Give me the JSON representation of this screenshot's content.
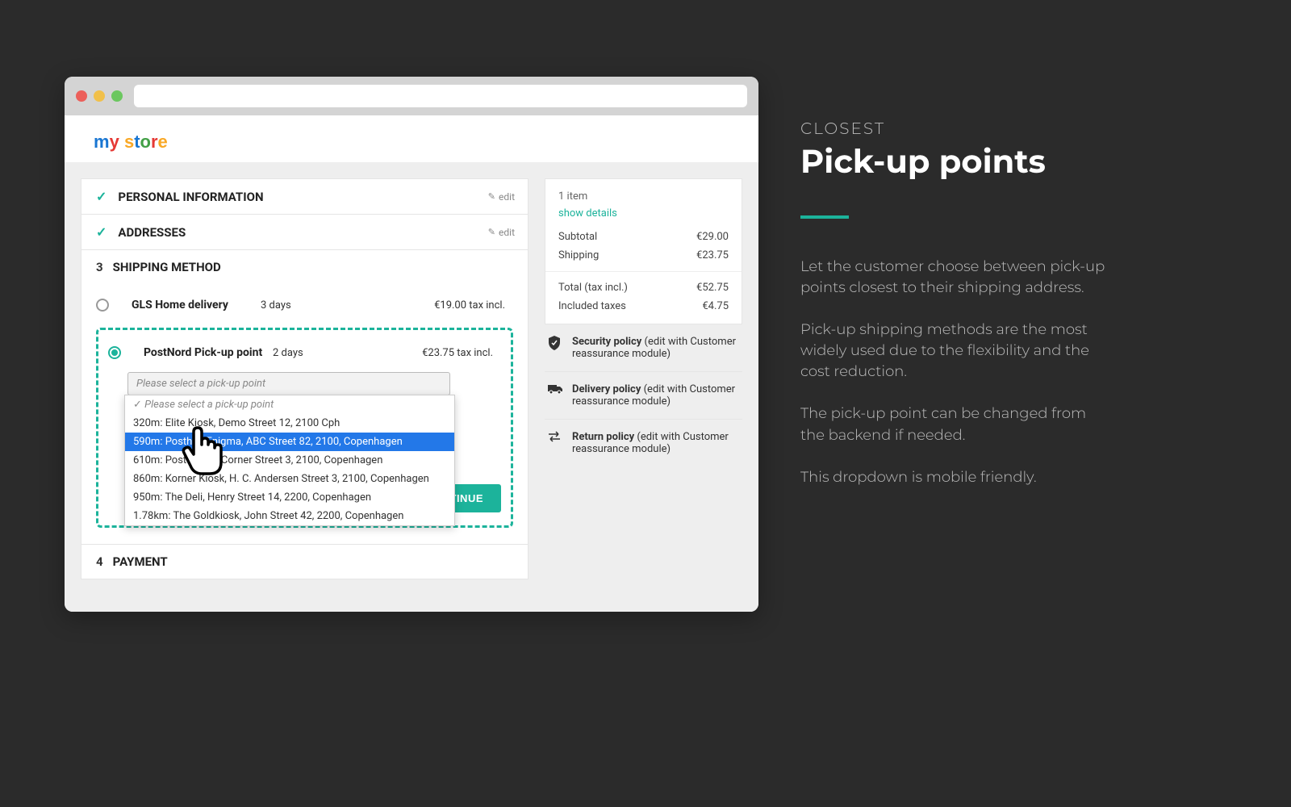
{
  "logo": "my store",
  "steps": {
    "personal": {
      "title": "PERSONAL INFORMATION",
      "edit": "edit"
    },
    "addresses": {
      "title": "ADDRESSES",
      "edit": "edit"
    },
    "shipping": {
      "num": "3",
      "title": "SHIPPING METHOD"
    },
    "payment": {
      "num": "4",
      "title": "PAYMENT"
    }
  },
  "shipping_options": [
    {
      "name": "GLS Home delivery",
      "days": "3 days",
      "price": "€19.00 tax incl."
    },
    {
      "name": "PostNord Pick-up point",
      "days": "2 days",
      "price": "€23.75 tax incl."
    }
  ],
  "dropdown": {
    "placeholder": "Please select a pick-up point",
    "items": [
      "320m: Elite Kiosk, Demo Street 12, 2100 Cph",
      "590m: Posthus Enigma, ABC Street 82, 2100, Copenhagen",
      "610m: Post Office, Corner Street 3, 2100, Copenhagen",
      "860m: Korner Kiosk, H. C. Andersen Street 3, 2100, Copenhagen",
      "950m: The Deli, Henry Street 14, 2200, Copenhagen",
      "1.78km: The Goldkiosk, John Street 42, 2200, Copenhagen"
    ],
    "selected_index": 1
  },
  "continue_label": "CONTINUE",
  "summary": {
    "items": "1 item",
    "show_details": "show details",
    "subtotal_label": "Subtotal",
    "subtotal_value": "€29.00",
    "shipping_label": "Shipping",
    "shipping_value": "€23.75",
    "total_label": "Total (tax incl.)",
    "total_value": "€52.75",
    "tax_label": "Included taxes",
    "tax_value": "€4.75"
  },
  "policies": [
    {
      "icon": "shield",
      "text_bold": "Security policy",
      "text_rest": " (edit with Customer reassurance module)"
    },
    {
      "icon": "truck",
      "text_bold": "Delivery policy",
      "text_rest": " (edit with Customer reassurance module)"
    },
    {
      "icon": "swap",
      "text_bold": "Return policy",
      "text_rest": " (edit with Customer reassurance module)"
    }
  ],
  "marketing": {
    "eyebrow": "CLOSEST",
    "title": "Pick-up points",
    "paras": [
      "Let the customer choose between pick-up points closest to their shipping address.",
      "Pick-up shipping methods are the most widely used due to the flexibility and the cost reduction.",
      "The pick-up point can be changed from the backend if needed.",
      "This dropdown is mobile friendly."
    ]
  }
}
